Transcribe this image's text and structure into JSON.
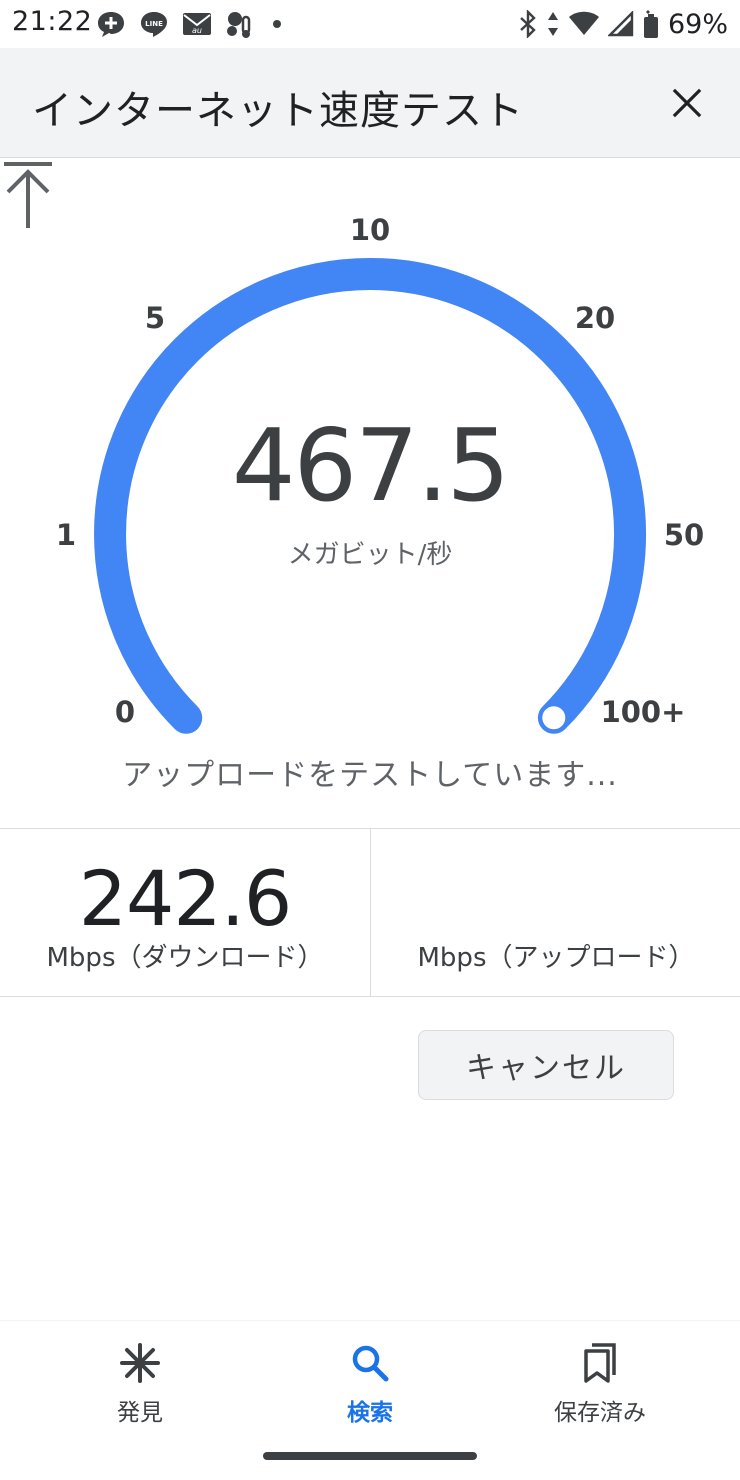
{
  "status_bar": {
    "time": "21:22",
    "battery": "69%",
    "icons_left": [
      "message-plus-icon",
      "line-app-icon",
      "au-mail-icon",
      "weather-icon",
      "dot-icon"
    ],
    "icons_right": [
      "bluetooth-icon",
      "data-arrows-icon",
      "wifi-icon",
      "signal-icon",
      "battery-icon"
    ]
  },
  "app_bar": {
    "title": "インターネット速度テスト",
    "close_icon": "close-icon"
  },
  "gauge": {
    "ticks": [
      "0",
      "1",
      "5",
      "10",
      "20",
      "50",
      "100+"
    ],
    "value": "467.5",
    "unit": "メガビット/秒",
    "level": 1.0,
    "status": "アップロードをテストしています...",
    "accent_color": "#4285f4",
    "arrow_icon": "upload-arrow-icon"
  },
  "results": {
    "download_value": "242.6",
    "download_label": "Mbps（ダウンロード）",
    "upload_value": "",
    "upload_label": "Mbps（アップロード）"
  },
  "actions": {
    "cancel_label": "キャンセル"
  },
  "bottom_nav": {
    "items": [
      {
        "label": "発見",
        "icon": "asterisk-icon",
        "active": false
      },
      {
        "label": "検索",
        "icon": "search-icon",
        "active": true
      },
      {
        "label": "保存済み",
        "icon": "bookmarks-icon",
        "active": false
      }
    ],
    "active_color": "#1a73e8"
  }
}
